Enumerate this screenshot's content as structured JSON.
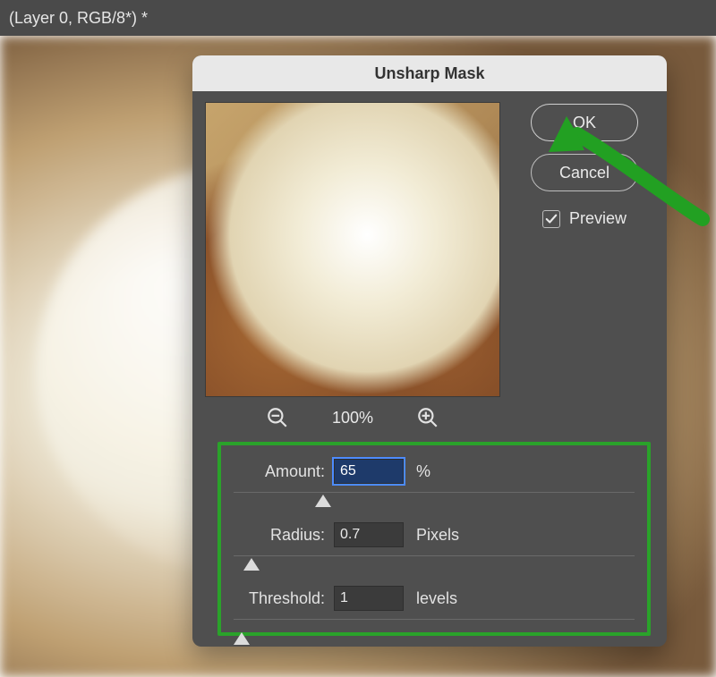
{
  "window": {
    "title": "(Layer 0, RGB/8*) *"
  },
  "dialog": {
    "title": "Unsharp Mask",
    "ok_label": "OK",
    "cancel_label": "Cancel",
    "preview_label": "Preview",
    "preview_checked": true,
    "zoom_level": "100%"
  },
  "params": {
    "amount": {
      "label": "Amount:",
      "value": "65",
      "unit": "%",
      "slider_percent": 22
    },
    "radius": {
      "label": "Radius:",
      "value": "0.7",
      "unit": "Pixels",
      "slider_percent": 4
    },
    "threshold": {
      "label": "Threshold:",
      "value": "1",
      "unit": "levels",
      "slider_percent": 4
    }
  },
  "icons": {
    "zoom_out": "zoom-out",
    "zoom_in": "zoom-in",
    "check": "checkmark"
  },
  "colors": {
    "annotation_green": "#2aa22a",
    "arrow_green": "#22a022"
  }
}
